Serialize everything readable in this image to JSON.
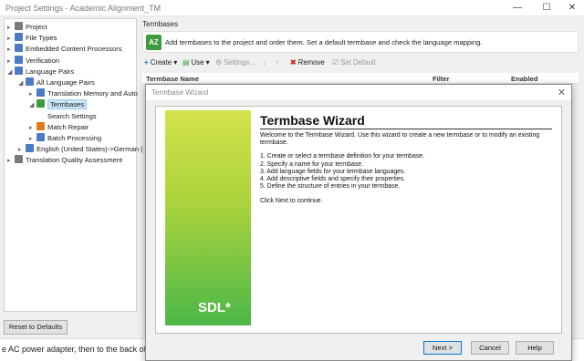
{
  "window": {
    "title": "Project Settings - Academic Alignment_TM"
  },
  "tree": {
    "items": [
      {
        "label": "Project",
        "color": "#7a7a7a",
        "expander": "▸",
        "indent": 0,
        "selected": false
      },
      {
        "label": "File Types",
        "color": "#4a7bc4",
        "expander": "▸",
        "indent": 0,
        "selected": false
      },
      {
        "label": "Embedded Content Processors",
        "color": "#4a7bc4",
        "expander": "▸",
        "indent": 0,
        "selected": false
      },
      {
        "label": "Verification",
        "color": "#4a7bc4",
        "expander": "▸",
        "indent": 0,
        "selected": false
      },
      {
        "label": "Language Pairs",
        "color": "#4a7bc4",
        "expander": "◢",
        "indent": 0,
        "selected": false
      },
      {
        "label": "All Language Pairs",
        "color": "#4a7bc4",
        "expander": "◢",
        "indent": 1,
        "selected": false
      },
      {
        "label": "Translation Memory and Auto",
        "color": "#4a7bc4",
        "expander": "▸",
        "indent": 2,
        "selected": false
      },
      {
        "label": "Termbases",
        "color": "#3c9b3c",
        "expander": "◢",
        "indent": 2,
        "selected": true
      },
      {
        "label": "Search Settings",
        "color": "",
        "expander": "",
        "indent": 3,
        "selected": false
      },
      {
        "label": "Match Repair",
        "color": "#e07b1a",
        "expander": "▸",
        "indent": 2,
        "selected": false
      },
      {
        "label": "Batch Processing",
        "color": "#4a7bc4",
        "expander": "▸",
        "indent": 2,
        "selected": false
      },
      {
        "label": "English (United States)->German (",
        "color": "#4a7bc4",
        "expander": "▸",
        "indent": 1,
        "selected": false
      },
      {
        "label": "Translation Quality Assessment",
        "color": "#7a7a7a",
        "expander": "▸",
        "indent": 0,
        "selected": false
      }
    ]
  },
  "right": {
    "header": "Termbases",
    "banner_icon": "AZ",
    "banner_text": "Add termbases to the project and order them. Set a default termbase and check the language mapping."
  },
  "toolbar": {
    "create": "Create",
    "use": "Use",
    "settings": "Settings...",
    "remove": "Remove",
    "set_default": "Set Default"
  },
  "grid": {
    "col_name": "Termbase Name",
    "col_filter": "Filter",
    "col_enabled": "Enabled"
  },
  "footer": {
    "reset_label": "Reset to Defaults",
    "background_text": "e AC power adapter, then to the back of the ph"
  },
  "modal": {
    "title": "Termbase Wizard",
    "heading": "Termbase Wizard",
    "logo": "SDL*",
    "intro": "Welcome to the Termbase Wizard. Use this wizard to create a new termbase or to modify an existing termbase.",
    "steps": [
      "1. Create or select a termbase definition for your termbase.",
      "2. Specify a name for your termbase.",
      "3. Add language fields for your termbase languages.",
      "4. Add descriptive fields and specify their properties.",
      "5. Define the structure of entries in your termbase."
    ],
    "outro": "Click Next to continue.",
    "buttons": {
      "next": "Next >",
      "cancel": "Cancel",
      "help": "Help"
    }
  }
}
